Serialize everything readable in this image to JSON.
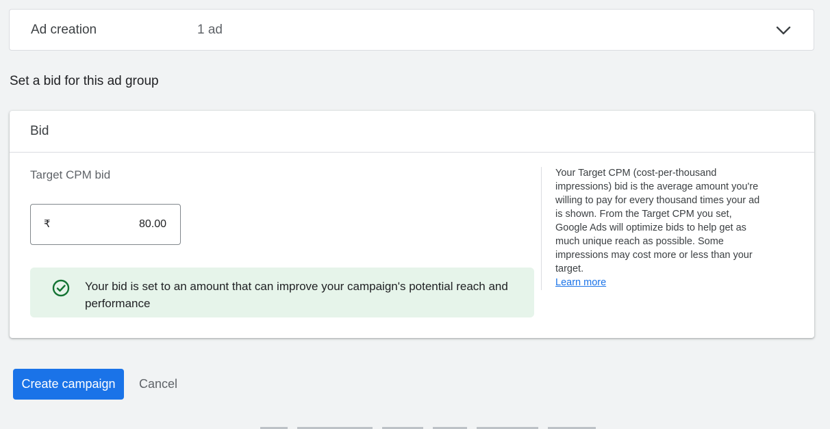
{
  "ad_creation": {
    "title": "Ad creation",
    "summary": "1 ad",
    "expand_icon": "chevron-down-icon"
  },
  "bid_section": {
    "heading": "Set a bid for this ad group"
  },
  "bid_card": {
    "title": "Bid",
    "field_label": "Target CPM bid",
    "currency_symbol": "₹",
    "bid_value": "80.00",
    "success_icon": "check-circle-icon",
    "success_message": "Your bid is set to an amount that can improve your campaign's potential reach and performance",
    "help_text": "Your Target CPM (cost-per-thousand impressions) bid is the average amount you're willing to pay for every thousand times your ad is shown. From the Target CPM you set, Google Ads will optimize bids to help get as much unique reach as possible. Some impressions may cost more or less than your target.",
    "learn_more": "Learn more"
  },
  "actions": {
    "create_label": "Create campaign",
    "cancel_label": "Cancel"
  },
  "colors": {
    "primary": "#1a73e8",
    "success_bg": "#e6f4ea",
    "success_icon": "#137333",
    "page_bg": "#f1f3f4"
  }
}
